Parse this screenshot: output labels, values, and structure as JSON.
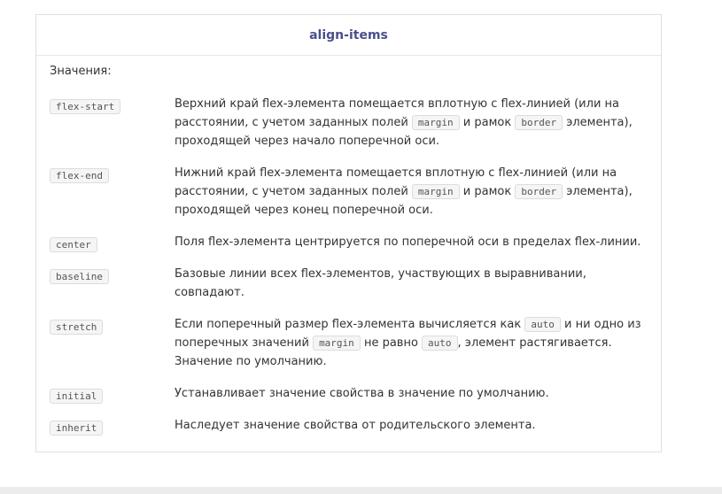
{
  "title": "align-items",
  "values_label": "Значения:",
  "rows": [
    {
      "key": "flex-start",
      "parts": [
        "Верхний край flex-элемента помещается вплотную с flex-линией (или на расстоянии, с учетом заданных полей ",
        "margin",
        " и рамок ",
        "border",
        " элемента), проходящей через начало поперечной оси."
      ]
    },
    {
      "key": "flex-end",
      "parts": [
        "Нижний край flex-элемента помещается вплотную с flex-линией (или на расстоянии, с учетом заданных полей ",
        "margin",
        " и рамок ",
        "border",
        " элемента), проходящей через конец поперечной оси."
      ]
    },
    {
      "key": "center",
      "parts": [
        "Поля flex-элемента центрируется по поперечной оси в пределах flex-линии."
      ]
    },
    {
      "key": "baseline",
      "parts": [
        "Базовые линии всех flex-элементов, участвующих в выравнивании, совпадают."
      ]
    },
    {
      "key": "stretch",
      "parts": [
        "Если поперечный размер flex-элемента вычисляется как ",
        "auto",
        " и ни одно из поперечных значений ",
        "margin",
        " не равно ",
        "auto",
        ", элемент растягивается. Значение по умолчанию."
      ]
    },
    {
      "key": "initial",
      "parts": [
        "Устанавливает значение свойства в значение по умолчанию."
      ]
    },
    {
      "key": "inherit",
      "parts": [
        "Наследует значение свойства от родительского элемента."
      ]
    }
  ]
}
